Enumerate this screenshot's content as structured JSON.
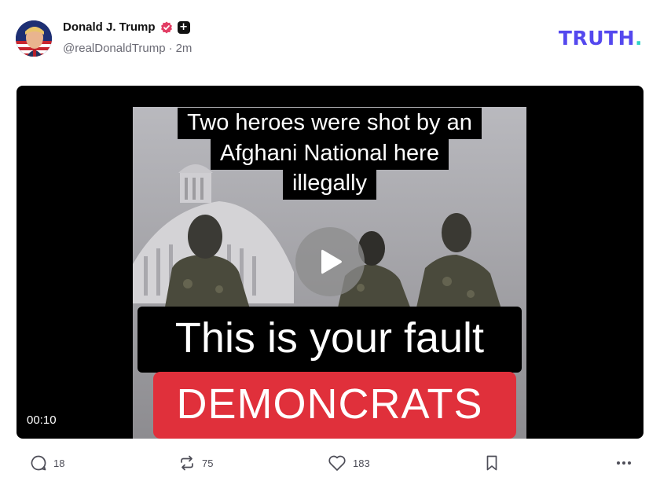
{
  "post": {
    "author_name": "Donald J. Trump",
    "handle": "@realDonaldTrump",
    "separator": "·",
    "time": "2m",
    "plus_badge": "+"
  },
  "brand": {
    "logo_text": "TRUTH",
    "logo_dot": "."
  },
  "video": {
    "caption_lines": [
      "Two heroes were shot by an",
      "Afghani National here",
      "illegally"
    ],
    "overlay_text": "This is your fault",
    "banner_text": "DEMONCRATS",
    "duration": "00:10",
    "play_icon": "play-icon"
  },
  "actions": {
    "replies": "18",
    "retruths": "75",
    "likes": "183"
  },
  "colors": {
    "brand": "#5448ee",
    "brand_dot": "#2fd3c6",
    "banner_red": "#e0303b",
    "verified": "#e23d64"
  }
}
